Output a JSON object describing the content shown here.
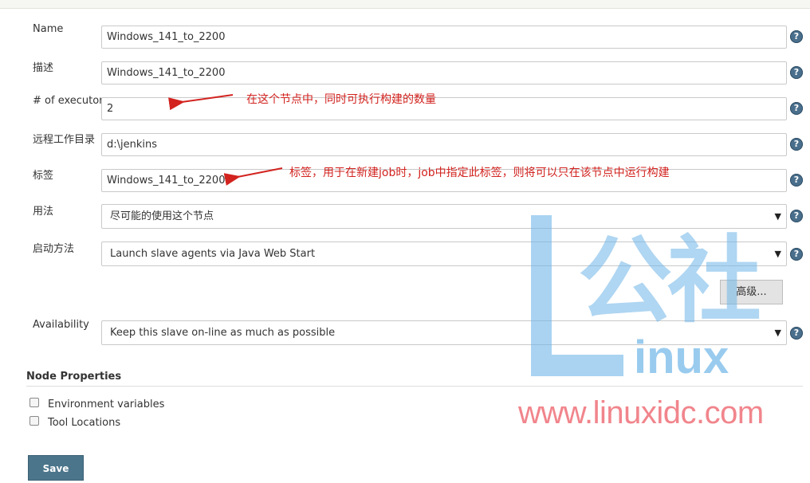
{
  "form": {
    "name": {
      "label": "Name",
      "value": "Windows_141_to_2200"
    },
    "description": {
      "label": "描述",
      "value": "Windows_141_to_2200"
    },
    "executors": {
      "label": "# of executors",
      "value": "2"
    },
    "remote_dir": {
      "label": "远程工作目录",
      "value": "d:\\jenkins"
    },
    "labels": {
      "label": "标签",
      "value": "Windows_141_to_2200"
    },
    "usage": {
      "label": "用法",
      "selected": "尽可能的使用这个节点"
    },
    "launch": {
      "label": "启动方法",
      "selected": "Launch slave agents via Java Web Start"
    },
    "advanced_label": "高级...",
    "availability": {
      "label": "Availability",
      "selected": "Keep this slave on-line as much as possible"
    }
  },
  "node_properties": {
    "title": "Node Properties",
    "items": [
      {
        "label": "Environment variables",
        "checked": false
      },
      {
        "label": "Tool Locations",
        "checked": false
      }
    ]
  },
  "help_glyph": "?",
  "select_arrow": "▼",
  "save_label": "Save",
  "annotations": {
    "executors_note": "在这个节点中，同时可执行构建的数量",
    "labels_note": "标签，用于在新建job时，job中指定此标签，则将可以只在该节点中运行构建"
  },
  "watermark": {
    "cn": "公社",
    "inux": "inux",
    "url": "www.linuxidc.com"
  },
  "colors": {
    "annotation": "#d2231f",
    "save_button": "#4b758b",
    "help_icon": "#4a6f8c",
    "watermark_blue": "#6fb6e8",
    "watermark_red": "#f07880"
  }
}
